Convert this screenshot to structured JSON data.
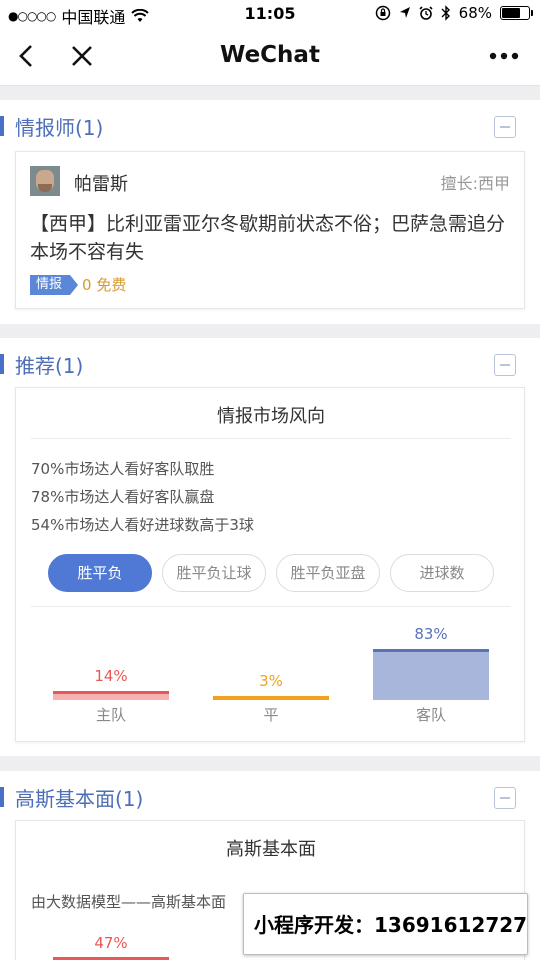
{
  "status_bar": {
    "carrier": "中国联通",
    "time": "11:05",
    "battery": "68%",
    "battery_level": 0.68
  },
  "nav": {
    "title": "WeChat"
  },
  "sections": {
    "analyst": {
      "title": "情报师(1)",
      "card": {
        "name": "帕雷斯",
        "specialty": "擅长:西甲",
        "text": "【西甲】比利亚雷亚尔冬歇期前状态不俗；巴萨急需追分本场不容有失",
        "tag": "情报",
        "price": "0 免费"
      }
    },
    "recommend": {
      "title": "推荐(1)",
      "card": {
        "title": "情报市场风向",
        "stats": [
          "70%市场达人看好客队取胜",
          "78%市场达人看好客队赢盘",
          "54%市场达人看好进球数高于3球"
        ],
        "tabs": [
          "胜平负",
          "胜平负让球",
          "胜平负亚盘",
          "进球数"
        ],
        "active_tab": 0
      }
    },
    "gauss": {
      "title": "高斯基本面(1)",
      "card": {
        "title": "高斯基本面",
        "desc": "由大数据模型——高斯基本面",
        "partial_pct": "47%"
      }
    }
  },
  "chart_data": {
    "type": "bar",
    "categories": [
      "主队",
      "平",
      "客队"
    ],
    "values": [
      14,
      3,
      83
    ],
    "value_labels": [
      "14%",
      "3%",
      "83%"
    ],
    "colors": [
      "#e85858",
      "#f0a21e",
      "#5a72b8"
    ],
    "ylim": [
      0,
      100
    ]
  },
  "watermark": {
    "text": "小程序开发：13691612727"
  },
  "colors": {
    "accent": "#4f79d4",
    "section_title": "#4d6fb8",
    "price": "#d99a2b"
  }
}
